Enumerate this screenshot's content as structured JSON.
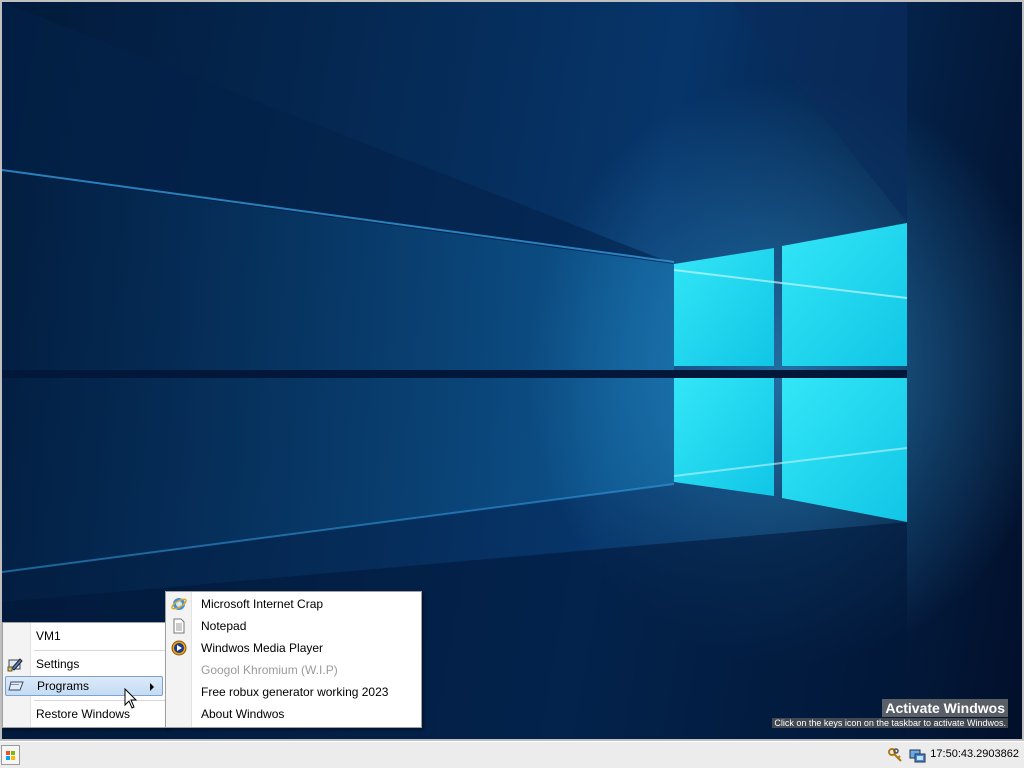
{
  "start_menu": {
    "items": [
      {
        "label": "VM1",
        "icon": null
      },
      {
        "label": "Settings",
        "icon": "settings-icon"
      },
      {
        "label": "Programs",
        "icon": "programs-icon",
        "highlighted": true,
        "has_submenu": true
      },
      {
        "label": "Restore Windows",
        "icon": null
      }
    ]
  },
  "programs_menu": {
    "items": [
      {
        "label": "Microsoft Internet Crap",
        "icon": "internet-explorer-icon",
        "enabled": true
      },
      {
        "label": "Notepad",
        "icon": "notepad-icon",
        "enabled": true
      },
      {
        "label": "Windwos Media Player",
        "icon": "media-player-icon",
        "enabled": true
      },
      {
        "label": "Googol Khromium (W.I.P)",
        "icon": null,
        "enabled": false
      },
      {
        "label": "Free robux generator working 2023",
        "icon": null,
        "enabled": true
      },
      {
        "label": "About Windwos",
        "icon": null,
        "enabled": true
      }
    ]
  },
  "watermark": {
    "title": "Activate Windwos",
    "subtitle": "Click on the keys icon on the taskbar to activate Windwos."
  },
  "taskbar": {
    "clock": "17:50:43.2903862",
    "tray_icons": [
      "keys-icon",
      "network-icon"
    ]
  },
  "colors": {
    "desktop_dark": "#021a3a",
    "window_light": "#20d8f0",
    "menu_highlight": "#c4dcf4",
    "taskbar": "#ececec"
  }
}
